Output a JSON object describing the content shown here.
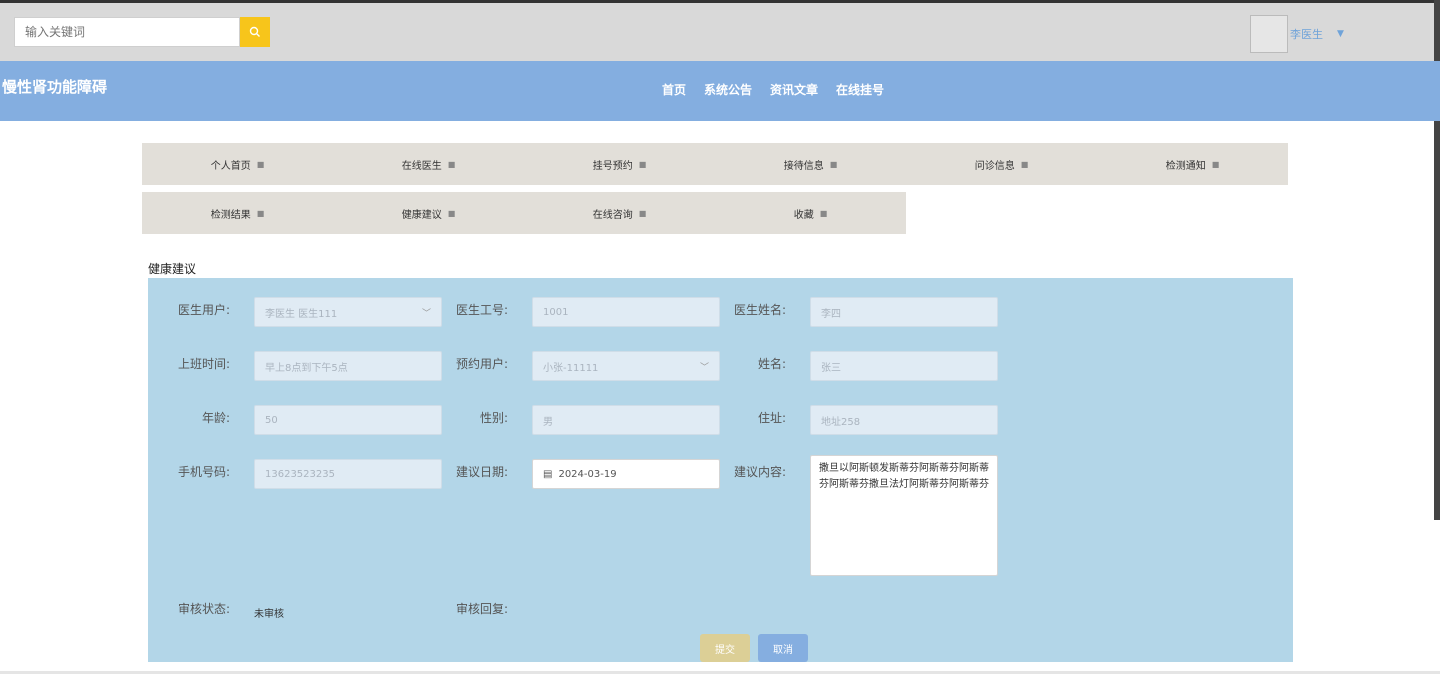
{
  "search": {
    "placeholder": "输入关键词"
  },
  "user": {
    "name": "李医生"
  },
  "brand": {
    "title": "慢性肾功能障碍"
  },
  "nav": {
    "links": [
      "首页",
      "系统公告",
      "资讯文章",
      "在线挂号"
    ]
  },
  "menu": {
    "row1": [
      "个人首页",
      "在线医生",
      "挂号预约",
      "接待信息",
      "问诊信息",
      "检测通知"
    ],
    "row2": [
      "检测结果",
      "健康建议",
      "在线咨询",
      "收藏"
    ]
  },
  "section": {
    "title": "健康建议"
  },
  "form": {
    "doctor_account_label": "医生用户:",
    "doctor_account_value": "李医生 医生111",
    "doctor_no_label": "医生工号:",
    "doctor_no_value": "1001",
    "doctor_name_label": "医生姓名:",
    "doctor_name_value": "李四",
    "work_time_label": "上班时间:",
    "work_time_value": "早上8点到下午5点",
    "booking_user_label": "预约用户:",
    "booking_user_value": "小张-11111",
    "name_label": "姓名:",
    "name_value": "张三",
    "age_label": "年龄:",
    "age_value": "50",
    "gender_label": "性别:",
    "gender_value": "男",
    "address_label": "住址:",
    "address_value": "地址258",
    "phone_label": "手机号码:",
    "phone_value": "13623523235",
    "advice_date_label": "建议日期:",
    "advice_date_value": "2024-03-19",
    "advice_content_label": "建议内容:",
    "advice_content_value": "撒旦以阿斯顿发斯蒂芬阿斯蒂芬阿斯蒂芬阿斯蒂芬撒旦法灯阿斯蒂芬阿斯蒂芬",
    "audit_status_label": "审核状态:",
    "audit_status_value": "未审核",
    "audit_reply_label": "审核回复:"
  },
  "buttons": {
    "submit": "提交",
    "cancel": "取消"
  },
  "colors": {
    "topbar": "#d9d9d9",
    "navbar": "#84aee0",
    "panel": "#b3d6e8",
    "search_btn": "#f7c51b"
  }
}
